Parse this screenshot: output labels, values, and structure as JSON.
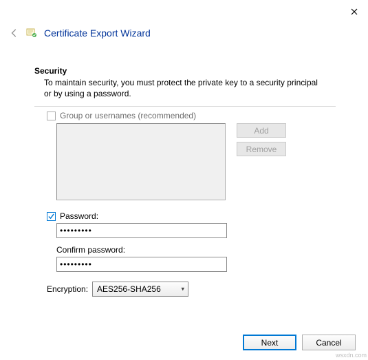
{
  "titlebar": {
    "close": "✕"
  },
  "header": {
    "title": "Certificate Export Wizard"
  },
  "section": {
    "label": "Security",
    "desc": "To maintain security, you must protect the private key to a security principal or by using a password."
  },
  "group": {
    "checkbox_label": "Group or usernames (recommended)",
    "add": "Add",
    "remove": "Remove"
  },
  "password": {
    "checkbox_label": "Password:",
    "value": "•••••••••",
    "confirm_label": "Confirm password:",
    "confirm_value": "•••••••••"
  },
  "encryption": {
    "label": "Encryption:",
    "selected": "AES256-SHA256"
  },
  "footer": {
    "next": "Next",
    "cancel": "Cancel"
  },
  "watermark": "wsxdn.com"
}
